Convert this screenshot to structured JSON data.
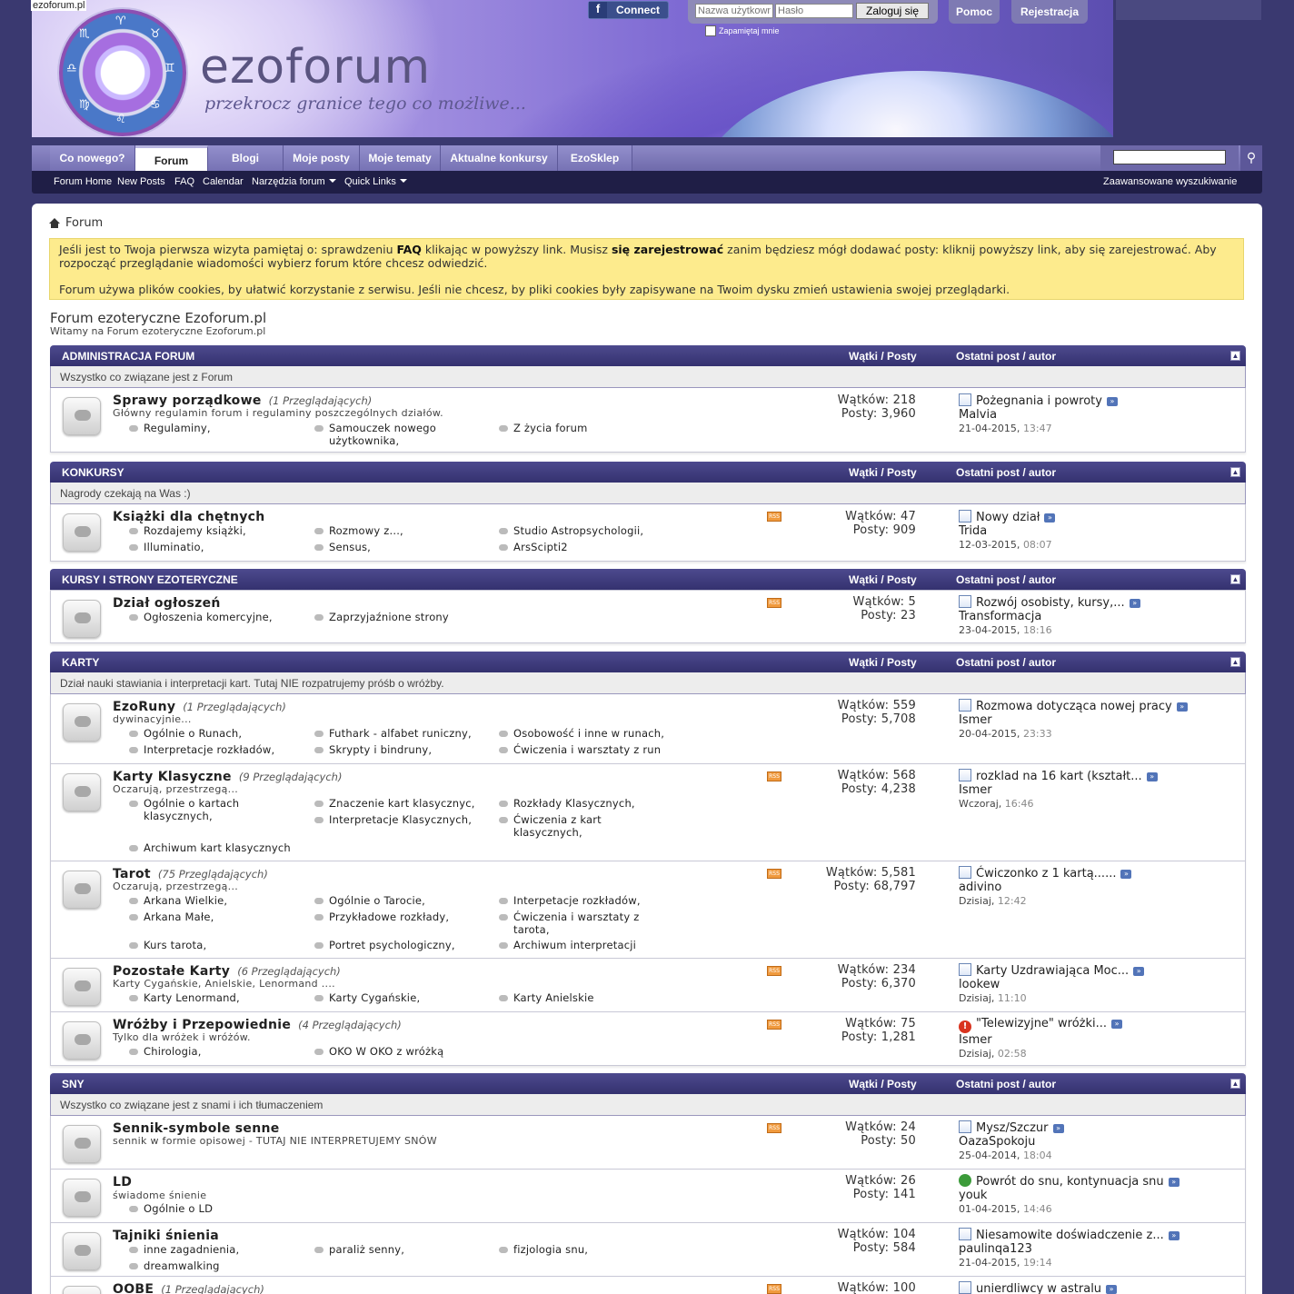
{
  "site": {
    "domain": "ezoforum.pl",
    "logo": "ezoforum",
    "tagline": "przekrocz granice tego co możliwe..."
  },
  "topbar": {
    "connect": "Connect",
    "username_placeholder": "Nazwa użytkownika",
    "password_placeholder": "Hasło",
    "login": "Zaloguj się",
    "remember": "Zapamiętaj mnie",
    "help": "Pomoc",
    "register": "Rejestracja"
  },
  "nav": {
    "tabs": [
      "Co nowego?",
      "Forum",
      "Blogi",
      "Moje posty",
      "Moje tematy",
      "Aktualne konkursy",
      "EzoSklep"
    ],
    "active": "Forum",
    "sublinks": [
      "Forum Home",
      "New Posts",
      "FAQ",
      "Calendar",
      "Narzędzia forum",
      "Quick Links"
    ],
    "advanced_search": "Zaawansowane wyszukiwanie"
  },
  "breadcrumb": "Forum",
  "notice": {
    "p1_a": "Jeśli jest to Twoja pierwsza wizyta pamiętaj o: sprawdzeniu ",
    "p1_faq": "FAQ",
    "p1_b": " klikając w powyższy link. Musisz ",
    "p1_reg": "się zarejestrować",
    "p1_c": " zanim będziesz mógł dodawać posty: kliknij powyższy link, aby się zarejestrować. Aby rozpocząć przeglądanie wiadomości wybierz forum które chcesz odwiedzić.",
    "p2": "Forum używa plików cookies, by ułatwić korzystanie z serwisu. Jeśli nie chcesz, by pliki cookies były zapisywane na Twoim dysku zmień ustawienia swojej przeglądarki."
  },
  "forum_title": "Forum ezoteryczne Ezoforum.pl",
  "forum_subtitle": "Witamy na Forum ezoteryczne Ezoforum.pl",
  "col_threads": "Wątki / Posty",
  "col_last": "Ostatni post / autor",
  "categories": [
    {
      "name": "ADMINISTRACJA FORUM",
      "desc": "Wszystko co związane jest z Forum"
    },
    {
      "name": "KONKURSY",
      "desc": "Nagrody czekają na Was :)"
    },
    {
      "name": "KURSY I STRONY EZOTERYCZNE",
      "desc": ""
    },
    {
      "name": "KARTY",
      "desc": "Dział nauki stawiania i interpretacji kart. Tutaj NIE rozpatrujemy próśb o wróżby."
    },
    {
      "name": "SNY",
      "desc": "Wszystko co związane jest z snami i ich tłumaczeniem"
    }
  ],
  "forums": [
    {
      "title": "Sprawy porządkowe",
      "viewers": "(1 Przeglądających)",
      "desc": "Główny regulamin forum i regulaminy poszczególnych działów.",
      "subs": [
        "Regulaminy,",
        "Samouczek nowego użytkownika,",
        "Z życia forum"
      ],
      "threads": "Wątków: 218",
      "posts": "Posty: 3,960",
      "last_title": "Pożegnania i powroty",
      "last_author": "Malvia",
      "last_date": "21-04-2015,",
      "last_time": "13:47"
    },
    {
      "title": "Książki dla chętnych",
      "viewers": "",
      "desc": "",
      "subs": [
        "Rozdajemy książki,",
        "Rozmowy z...,",
        "Studio Astropsychologii,",
        "Illuminatio,",
        "Sensus,",
        "ArsScipti2"
      ],
      "threads": "Wątków: 47",
      "posts": "Posty: 909",
      "last_title": "Nowy dział",
      "last_author": "Trida",
      "last_date": "12-03-2015,",
      "last_time": "08:07"
    },
    {
      "title": "Dział ogłoszeń",
      "viewers": "",
      "desc": "",
      "subs": [
        "Ogłoszenia komercyjne,",
        "Zaprzyjaźnione strony"
      ],
      "threads": "Wątków: 5",
      "posts": "Posty: 23",
      "last_title": "Rozwój osobisty, kursy,...",
      "last_author": "Transformacja",
      "last_date": "23-04-2015,",
      "last_time": "18:16"
    },
    {
      "title": "EzoRuny",
      "viewers": "(1 Przeglądających)",
      "desc": "dywinacyjnie...",
      "subs": [
        "Ogólnie o Runach,",
        "Futhark - alfabet runiczny,",
        "Osobowość i inne w runach,",
        "Interpretacje rozkładów,",
        "Skrypty i bindruny,",
        "Ćwiczenia i warsztaty z run"
      ],
      "threads": "Wątków: 559",
      "posts": "Posty: 5,708",
      "last_title": "Rozmowa dotycząca nowej pracy",
      "last_author": "Ismer",
      "last_date": "20-04-2015,",
      "last_time": "23:33"
    },
    {
      "title": "Karty Klasyczne",
      "viewers": "(9 Przeglądających)",
      "desc": "Oczarują, przestrzegą...",
      "subs": [
        "Ogólnie o kartach klasycznych,",
        "Znaczenie kart klasycznyc,",
        "Rozkłady Klasycznych,",
        "Interpretacje Klasycznych,",
        "Ćwiczenia z kart klasycznych,",
        "Archiwum kart klasycznych"
      ],
      "threads": "Wątków: 568",
      "posts": "Posty: 4,238",
      "last_title": "rozklad na 16 kart (kształt...",
      "last_author": "Ismer",
      "last_date": "Wczoraj,",
      "last_time": "16:46"
    },
    {
      "title": "Tarot",
      "viewers": "(75 Przeglądających)",
      "desc": "Oczarują, przestrzegą...",
      "subs": [
        "Arkana Wielkie,",
        "Ogólnie o Tarocie,",
        "Interpetacje rozkładów,",
        "Arkana Małe,",
        "Przykładowe rozkłady,",
        "Ćwiczenia i warsztaty z tarota,",
        "Kurs tarota,",
        "Portret psychologiczny,",
        "Archiwum interpretacji"
      ],
      "threads": "Wątków: 5,581",
      "posts": "Posty: 68,797",
      "last_title": "Ćwiczonko z 1 kartą......",
      "last_author": "adivino",
      "last_date": "Dzisiaj,",
      "last_time": "12:42"
    },
    {
      "title": "Pozostałe Karty",
      "viewers": "(6 Przeglądających)",
      "desc": "Karty Cygańskie, Anielskie, Lenormand ....",
      "subs": [
        "Karty Lenormand,",
        "Karty Cygańskie,",
        "Karty Anielskie"
      ],
      "threads": "Wątków: 234",
      "posts": "Posty: 6,370",
      "last_title": "Karty Uzdrawiająca Moc...",
      "last_author": "lookew",
      "last_date": "Dzisiaj,",
      "last_time": "11:10"
    },
    {
      "title": "Wróżby i Przepowiednie",
      "viewers": "(4 Przeglądających)",
      "desc": "Tylko dla wróżek i wróżów.",
      "subs": [
        "Chirologia,",
        "OKO W OKO z wróżką"
      ],
      "threads": "Wątków: 75",
      "posts": "Posty: 1,281",
      "last_title": "\"Telewizyjne\" wróżki...",
      "last_author": "Ismer",
      "last_date": "Dzisiaj,",
      "last_time": "02:58"
    },
    {
      "title": "Sennik-symbole senne",
      "viewers": "",
      "desc": "sennik w formie opisowej - TUTAJ NIE INTERPRETUJEMY SNÓW",
      "subs": [],
      "threads": "Wątków: 24",
      "posts": "Posty: 50",
      "last_title": "Mysz/Szczur",
      "last_author": "OazaSpokoju",
      "last_date": "25-04-2014,",
      "last_time": "18:04"
    },
    {
      "title": "LD",
      "viewers": "",
      "desc": "świadome śnienie",
      "subs": [
        "Ogólnie o LD"
      ],
      "threads": "Wątków: 26",
      "posts": "Posty: 141",
      "last_title": "Powrót do snu, kontynuacja snu",
      "last_author": "youk",
      "last_date": "01-04-2015,",
      "last_time": "14:46"
    },
    {
      "title": "Tajniki śnienia",
      "viewers": "",
      "desc": "",
      "subs": [
        "inne zagadnienia,",
        "paraliż senny,",
        "fizjologia snu,",
        "dreamwalking"
      ],
      "threads": "Wątków: 104",
      "posts": "Posty: 584",
      "last_title": "Niesamowite doświadczenie z...",
      "last_author": "paulinqa123",
      "last_date": "21-04-2015,",
      "last_time": "19:14"
    },
    {
      "title": "OOBE",
      "viewers": "(1 Przeglądających)",
      "desc": "",
      "subs": [],
      "threads": "Wątków: 100",
      "posts": "",
      "last_title": "unierdliwcy w astralu",
      "last_author": "",
      "last_date": "",
      "last_time": ""
    }
  ]
}
